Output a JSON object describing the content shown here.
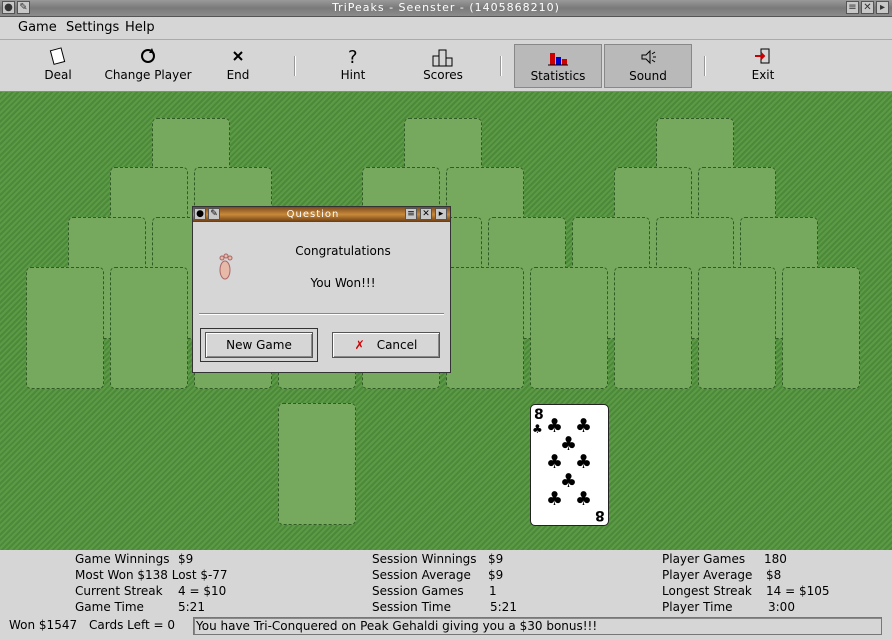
{
  "window": {
    "title": "TriPeaks - Seenster - (1405868210)"
  },
  "menu": {
    "items": [
      "Game",
      "Settings",
      "Help"
    ]
  },
  "toolbar": {
    "deal": "Deal",
    "change_player": "Change Player",
    "end": "End",
    "hint": "Hint",
    "scores": "Scores",
    "statistics": "Statistics",
    "sound": "Sound",
    "exit": "Exit"
  },
  "card": {
    "rank": "8",
    "suit": "club"
  },
  "dialog": {
    "title": "Question",
    "line1": "Congratulations",
    "line2": "You Won!!!",
    "new_game": "New Game",
    "cancel": "Cancel"
  },
  "stats": {
    "game_winnings_label": "Game Winnings",
    "game_winnings": "$9",
    "most_won": "Most Won $138 Lost $-77",
    "current_streak_label": "Current Streak",
    "current_streak": "4 = $10",
    "game_time_label": "Game Time",
    "game_time": "5:21",
    "session_winnings_label": "Session Winnings",
    "session_winnings": "$9",
    "session_average_label": "Session Average",
    "session_average": "$9",
    "session_games_label": "Session Games",
    "session_games": "1",
    "session_time_label": "Session Time",
    "session_time": "5:21",
    "player_games_label": "Player Games",
    "player_games": "180",
    "player_average_label": "Player Average",
    "player_average": "$8",
    "longest_streak_label": "Longest Streak",
    "longest_streak": "14 = $105",
    "player_time_label": "Player Time",
    "player_time": "3:00"
  },
  "statusbar": {
    "won": "Won $1547",
    "cards_left": "Cards Left = 0",
    "message": "You have Tri-Conquered on Peak Gehaldi giving you a $30 bonus!!!"
  },
  "colors": {
    "felt": "#4c8a3a",
    "slot": "#76a85e",
    "dialog_title": "#b07030"
  }
}
